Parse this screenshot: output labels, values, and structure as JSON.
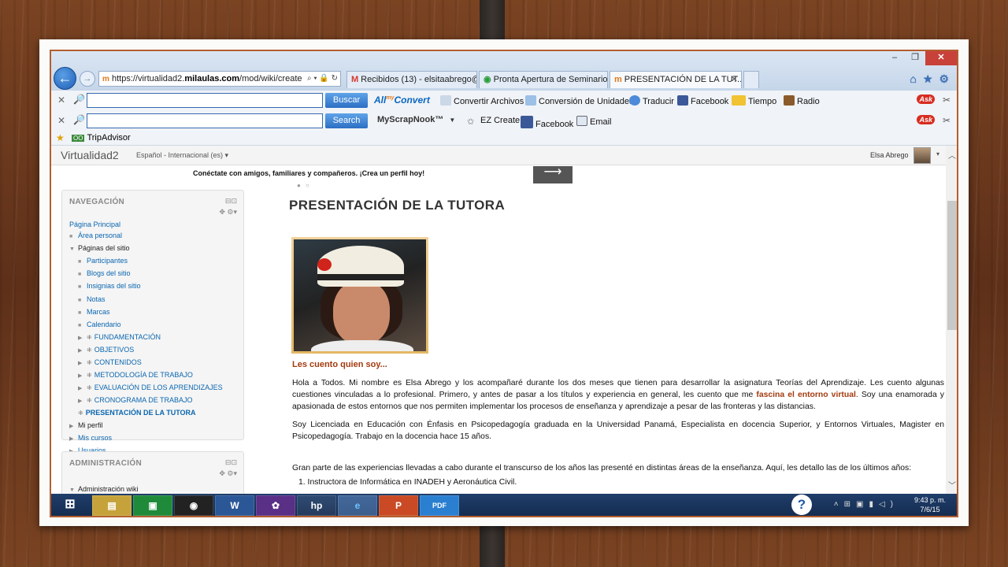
{
  "browser": {
    "address": {
      "prefix": "https://virtualidad2.",
      "domain": "milaulas.com",
      "path": "/mod/wiki/create"
    },
    "tabs": [
      {
        "label": "Recibidos (13) - elsitaabrego@...",
        "icon": "gmail-icon"
      },
      {
        "label": "Pronta Apertura de Seminario ...",
        "icon": "chrome-icon"
      },
      {
        "label": "PRESENTACIÓN DE LA TUT...",
        "icon": "moodle-icon"
      }
    ],
    "window_controls": {
      "minimize": "–",
      "restore": "❐",
      "close": "✕"
    }
  },
  "toolbar1": {
    "search_button": "Buscar",
    "allmyconvert": {
      "pre": "All",
      "mid": "my",
      "post": "Convert"
    },
    "items": [
      "Convertir Archivos",
      "Conversión de Unidades",
      "Traducir",
      "Facebook",
      "Tiempo",
      "Radio"
    ]
  },
  "toolbar2": {
    "search_button": "Search",
    "brand": "MyScrapNook™",
    "items": [
      "EZ Create",
      "Facebook",
      "Email"
    ]
  },
  "ask_label": "Ask",
  "favorites": {
    "item": "TripAdvisor",
    "icon_text": "OO"
  },
  "moodle": {
    "brand": "Virtualidad2",
    "language": "Español - Internacional (es) ▾",
    "user": "Elsa Abrego",
    "banner_text": "Conéctate con amigos, familiares y compañeros. ¡Crea un perfil hoy!",
    "banner_arrow": "⟶"
  },
  "nav_block": {
    "title": "NAVEGACIÓN",
    "items": [
      {
        "label": "Página Principal",
        "kind": "root"
      },
      {
        "label": "Área personal",
        "kind": "bullet"
      },
      {
        "label": "Páginas del sitio",
        "kind": "open"
      },
      {
        "label": "Participantes",
        "kind": "sub-bullet"
      },
      {
        "label": "Blogs del sitio",
        "kind": "sub-bullet"
      },
      {
        "label": "Insignias del sitio",
        "kind": "sub-bullet"
      },
      {
        "label": "Notas",
        "kind": "sub-bullet"
      },
      {
        "label": "Marcas",
        "kind": "sub-bullet"
      },
      {
        "label": "Calendario",
        "kind": "sub-bullet"
      },
      {
        "label": "FUNDAMENTACIÓN",
        "kind": "sub-tri"
      },
      {
        "label": "OBJETIVOS",
        "kind": "sub-tri"
      },
      {
        "label": "CONTENIDOS",
        "kind": "sub-tri"
      },
      {
        "label": "METODOLOGÍA DE TRABAJO",
        "kind": "sub-tri"
      },
      {
        "label": "EVALUACIÓN DE LOS APRENDIZAJES",
        "kind": "sub-tri"
      },
      {
        "label": "CRONOGRAMA DE TRABAJO",
        "kind": "sub-tri"
      },
      {
        "label": "PRESENTACIÓN DE LA TUTORA",
        "kind": "current"
      },
      {
        "label": "Mi perfil",
        "kind": "closed-plain"
      },
      {
        "label": "Mis cursos",
        "kind": "closed"
      },
      {
        "label": "Usuarios",
        "kind": "closed"
      }
    ]
  },
  "admin_block": {
    "title": "ADMINISTRACIÓN",
    "first_item": "Administración wiki"
  },
  "page": {
    "title": "PRESENTACIÓN DE LA TUTORA",
    "subtitle": "Les cuento quien soy...",
    "p1_a": "Hola a Todos. Mi nombre es Elsa Abrego y los acompañaré durante los dos meses que tienen para desarrollar la asignatura Teorías del Aprendizaje. Les cuento algunas cuestiones vinculadas a lo profesional. Primero, y antes de pasar a los títulos y experiencia en general, les cuento que me ",
    "p1_hl": "fascina el entorno virtual",
    "p1_b": ". Soy una enamorada y apasionada de estos entornos que nos permiten implementar los procesos de enseñanza y aprendizaje a pesar de las fronteras y las distancias.",
    "p2": "Soy Licenciada en Educación con Énfasis en Psicopedagogía graduada en la Universidad Panamá, Especialista en docencia Superior, y Entornos Virtuales,  Magister en Psicopedagogía. Trabajo en la docencia hace 15 años.",
    "p3": "Gran parte de las experiencias llevadas a cabo durante el transcurso de los años las presenté en distintas áreas de la enseñanza. Aquí, les detallo las de los últimos años:",
    "list_item_1": "1.   Instructora de Informática en  INADEH y Aeronáutica Civil."
  },
  "taskbar": {
    "apps": [
      "file-explorer",
      "store",
      "camera",
      "word",
      "photos",
      "hp",
      "internet-explorer",
      "powerpoint",
      "pdf"
    ],
    "labels": {
      "word": "W",
      "hp": "hp",
      "ie": "e",
      "ppt": "P",
      "pdf": "PDF"
    },
    "time": "9:43 p. m.",
    "date": "7/6/15"
  }
}
